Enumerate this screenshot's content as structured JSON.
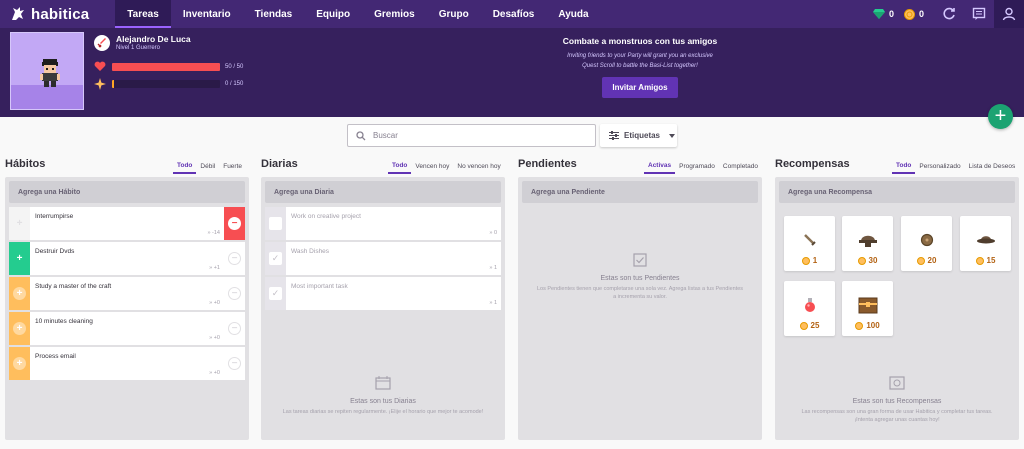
{
  "brand": {
    "name": "habitica"
  },
  "nav": {
    "items": [
      {
        "label": "Tareas"
      },
      {
        "label": "Inventario"
      },
      {
        "label": "Tiendas"
      },
      {
        "label": "Equipo"
      },
      {
        "label": "Gremios"
      },
      {
        "label": "Grupo"
      },
      {
        "label": "Desafíos"
      },
      {
        "label": "Ayuda"
      }
    ],
    "gems": "0",
    "gold": "0"
  },
  "member": {
    "name": "Alejandro De Luca",
    "level": "Nivel 1 Guerrero",
    "hp_text": "50 / 50",
    "hp_fraction": 1.0,
    "xp_text": "0 / 150",
    "xp_fraction": 0.0,
    "hp_color": "#f74e52",
    "xp_color": "#ffa624"
  },
  "party": {
    "title": "Combate a monstruos con tus amigos",
    "desc_line1": "Inviting friends to your Party will grant you an exclusive",
    "desc_line2": "Quest Scroll to battle the Basi-List together!",
    "invite_label": "Invitar Amigos"
  },
  "search": {
    "placeholder": "Buscar"
  },
  "tags": {
    "label": "Etiquetas"
  },
  "habits": {
    "title": "Hábitos",
    "filters": [
      "Todo",
      "Débil",
      "Fuerte"
    ],
    "add_placeholder": "Agrega una Hábito",
    "items": [
      {
        "title": "Interrumpirse",
        "streak": "-14"
      },
      {
        "title": "Destruir Dvds",
        "streak": "+1"
      },
      {
        "title": "Study a master of the craft",
        "streak": "+0"
      },
      {
        "title": "10 minutes cleaning",
        "streak": "+0"
      },
      {
        "title": "Process email",
        "streak": "+0"
      }
    ]
  },
  "dailies": {
    "title": "Diarias",
    "filters": [
      "Todo",
      "Vencen hoy",
      "No vencen hoy"
    ],
    "add_placeholder": "Agrega una Diaria",
    "items": [
      {
        "title": "Work on creative project",
        "streak": "0"
      },
      {
        "title": "Wash Dishes",
        "streak": "1"
      },
      {
        "title": "Most important task",
        "streak": "1"
      }
    ],
    "empty_title": "Estas son tus Diarias",
    "empty_desc": "Las tareas diarias se repiten regularmente. ¡Elije el horario que mejor te acomode!"
  },
  "todos": {
    "title": "Pendientes",
    "filters": [
      "Activas",
      "Programado",
      "Completado"
    ],
    "add_placeholder": "Agrega una Pendiente",
    "empty_title": "Estas son tus Pendientes",
    "empty_desc": "Los Pendientes tienen que completarse una sola vez. Agrega listas a tus Pendientes a incrementa su valor."
  },
  "rewards": {
    "title": "Recompensas",
    "filters": [
      "Todo",
      "Personalizado",
      "Lista de Deseos"
    ],
    "add_placeholder": "Agrega una Recompensa",
    "items": [
      {
        "icon": "sword-icon",
        "price": "1"
      },
      {
        "icon": "helmet-icon",
        "price": "30"
      },
      {
        "icon": "shield-icon",
        "price": "20"
      },
      {
        "icon": "hat-icon",
        "price": "15"
      },
      {
        "icon": "health-potion-icon",
        "price": "25"
      },
      {
        "icon": "chest-icon",
        "price": "100"
      }
    ],
    "empty_title": "Estas son tus Recompensas",
    "empty_desc": "Las recompensas son una gran forma de usar Habitica y completar tus tareas. ¡Intenta agregar unas cuantas hoy!"
  }
}
